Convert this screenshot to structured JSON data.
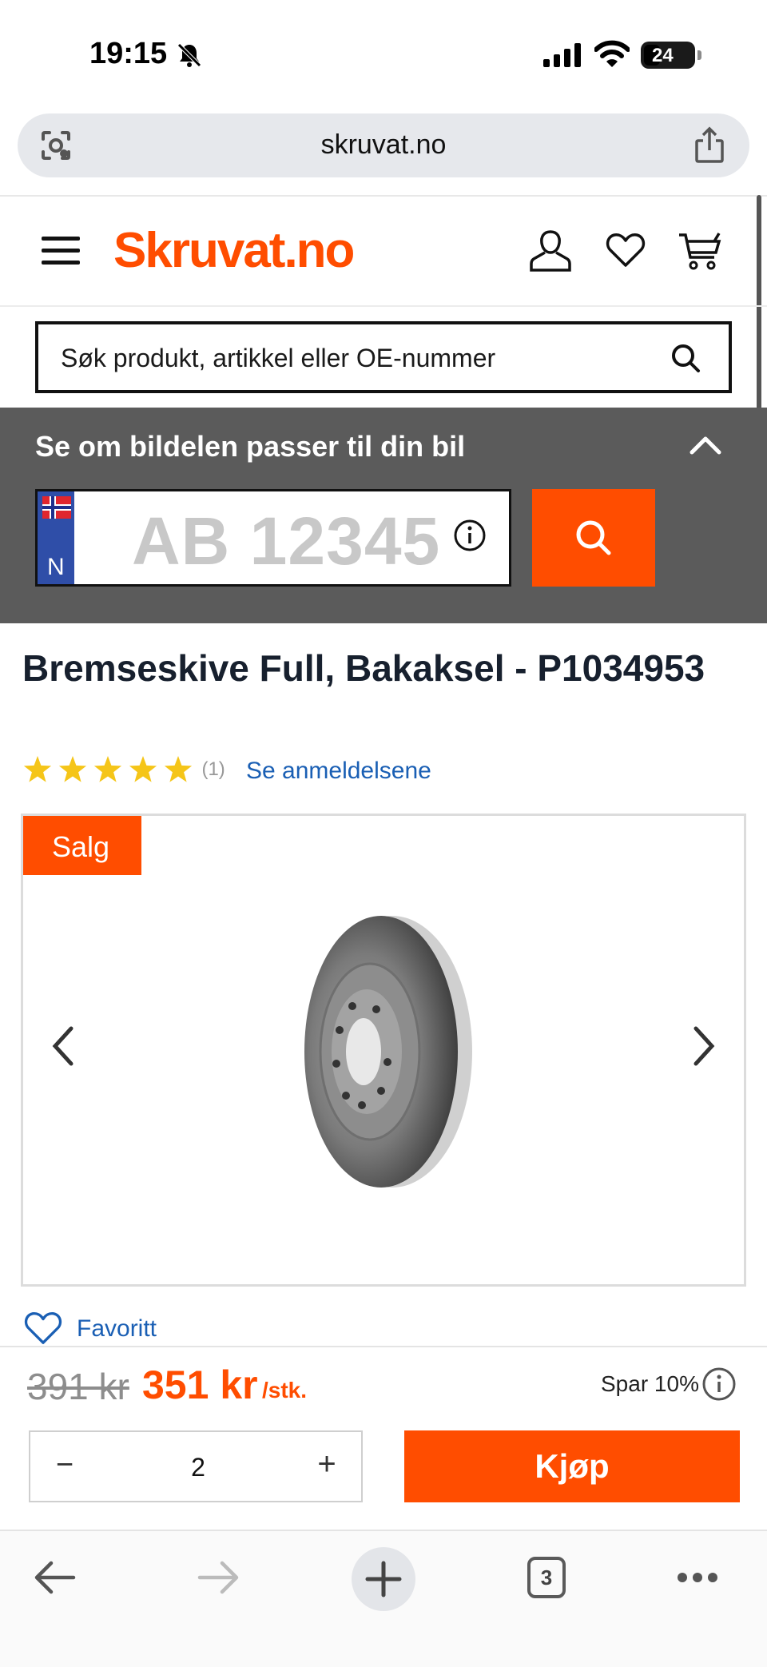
{
  "status_bar": {
    "time": "19:15",
    "battery": "24"
  },
  "browser": {
    "url": "skruvat.no",
    "tab_count": "3"
  },
  "header": {
    "logo": "Skruvat.no"
  },
  "search": {
    "placeholder": "Søk produkt, artikkel eller OE-nummer"
  },
  "plate_panel": {
    "title": "Se om bildelen passer til din bil",
    "country": "N",
    "placeholder": "AB 12345"
  },
  "product": {
    "title": "Bremseskive Full, Bakaksel - P1034953",
    "rating": 5,
    "review_count": "(1)",
    "reviews_link": "Se anmeldelsene",
    "badge": "Salg",
    "favorite_label": "Favoritt",
    "old_price": "391 kr",
    "new_price": "351 kr",
    "unit": "/stk.",
    "savings": "Spar 10%",
    "quantity": "2",
    "quantity_minus": "−",
    "quantity_plus": "+",
    "buy_label": "Kjøp"
  },
  "colors": {
    "accent": "#ff4d00",
    "link": "#1a5fb4",
    "panel": "#5b5b5b",
    "star": "#f5c518"
  },
  "icons": [
    "camera-search-icon",
    "share-icon",
    "menu-icon",
    "user-icon",
    "heart-icon",
    "cart-icon",
    "search-icon",
    "chevron-up-icon",
    "info-icon",
    "chevron-left-icon",
    "chevron-right-icon",
    "back-icon",
    "forward-icon",
    "plus-icon",
    "more-icon"
  ]
}
